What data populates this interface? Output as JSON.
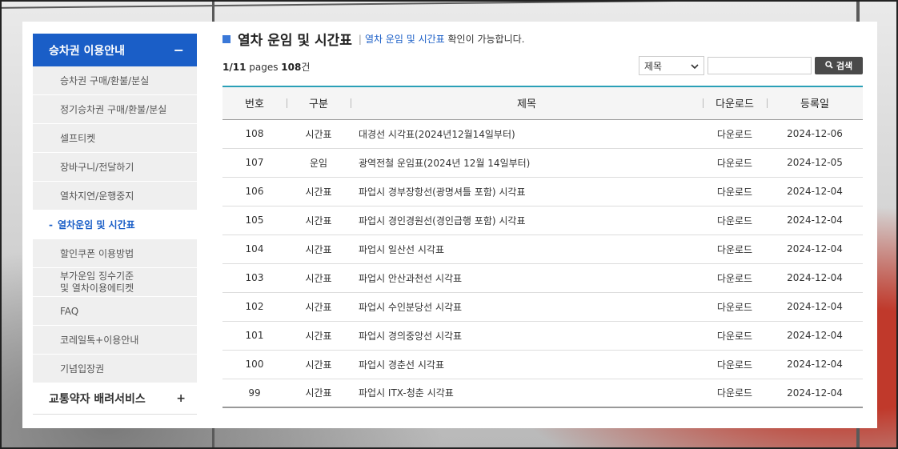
{
  "sidebar": {
    "header": {
      "label": "승차권 이용안내",
      "toggle": "−"
    },
    "items": [
      {
        "label": "승차권 구매/환불/분실"
      },
      {
        "label": "정기승차권 구매/환불/분실"
      },
      {
        "label": "셀프티켓"
      },
      {
        "label": "장바구니/전달하기"
      },
      {
        "label": "열차지연/운행중지"
      },
      {
        "label": "열차운임 및 시간표",
        "marker": "-"
      },
      {
        "label": "할인쿠폰 이용방법"
      },
      {
        "label_line1": "부가운임 징수기준",
        "label_line2": "및 열차이용에티켓"
      },
      {
        "label": "FAQ"
      },
      {
        "label": "코레일톡+이용안내"
      },
      {
        "label": "기념입장권"
      }
    ],
    "footer": {
      "label": "교통약자 배려서비스",
      "toggle": "+"
    }
  },
  "main": {
    "title": "열차 운임 및 시간표",
    "subtitle_sep": "|",
    "subtitle_highlight": "열차 운임 및 시간표",
    "subtitle_rest": " 확인이 가능합니다.",
    "pager": {
      "page": "1/11",
      "pages_label": " pages ",
      "count": "108",
      "count_unit": "건"
    },
    "search": {
      "select_value": "제목",
      "input_value": "",
      "button_label": "검색"
    },
    "table": {
      "headers": [
        "번호",
        "구분",
        "제목",
        "다운로드",
        "등록일"
      ],
      "rows": [
        {
          "no": "108",
          "type": "시간표",
          "title": "대경선 시각표(2024년12월14일부터)",
          "download": "다운로드",
          "date": "2024-12-06"
        },
        {
          "no": "107",
          "type": "운임",
          "title": "광역전철 운임표(2024년 12월 14일부터)",
          "download": "다운로드",
          "date": "2024-12-05"
        },
        {
          "no": "106",
          "type": "시간표",
          "title": "파업시 경부장항선(광명셔틀 포함) 시각표",
          "download": "다운로드",
          "date": "2024-12-04"
        },
        {
          "no": "105",
          "type": "시간표",
          "title": "파업시 경인경원선(경인급행 포함) 시각표",
          "download": "다운로드",
          "date": "2024-12-04"
        },
        {
          "no": "104",
          "type": "시간표",
          "title": "파업시 일산선 시각표",
          "download": "다운로드",
          "date": "2024-12-04"
        },
        {
          "no": "103",
          "type": "시간표",
          "title": "파업시 안산과천선 시각표",
          "download": "다운로드",
          "date": "2024-12-04"
        },
        {
          "no": "102",
          "type": "시간표",
          "title": "파업시 수인분당선 시각표",
          "download": "다운로드",
          "date": "2024-12-04"
        },
        {
          "no": "101",
          "type": "시간표",
          "title": "파업시 경의중앙선 시각표",
          "download": "다운로드",
          "date": "2024-12-04"
        },
        {
          "no": "100",
          "type": "시간표",
          "title": "파업시 경춘선 시각표",
          "download": "다운로드",
          "date": "2024-12-04"
        },
        {
          "no": "99",
          "type": "시간표",
          "title": "파업시 ITX-청춘 시각표",
          "download": "다운로드",
          "date": "2024-12-04"
        }
      ]
    }
  },
  "colors": {
    "accent": "#1a5ec7",
    "table_top": "#2aa0b7",
    "search_button": "#4a4a4a"
  }
}
